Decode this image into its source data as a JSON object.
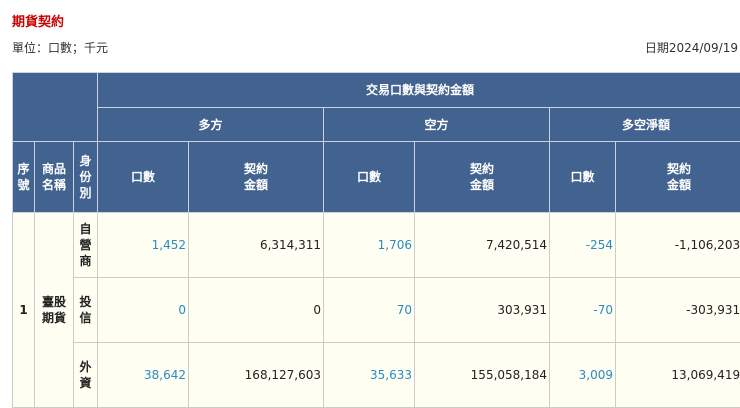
{
  "title": "期貨契約",
  "unit": "單位：口數；千元",
  "date": "日期2024/09/19",
  "header": {
    "group": "交易口數與契約金額",
    "long": "多方",
    "short": "空方",
    "net": "多空淨額",
    "seq": "序號",
    "product": "商品名稱",
    "identity": "身份別",
    "lots": "口數",
    "amount": "契約金額"
  },
  "rows": [
    {
      "seq": "1",
      "product": "臺股期貨",
      "identity": "自營商",
      "long_lots": "1,452",
      "long_amount": "6,314,311",
      "short_lots": "1,706",
      "short_amount": "7,420,514",
      "net_lots": "-254",
      "net_amount": "-1,106,203"
    },
    {
      "identity": "投信",
      "long_lots": "0",
      "long_amount": "0",
      "short_lots": "70",
      "short_amount": "303,931",
      "net_lots": "-70",
      "net_amount": "-303,931"
    },
    {
      "identity": "外資",
      "long_lots": "38,642",
      "long_amount": "168,127,603",
      "short_lots": "35,633",
      "short_amount": "155,058,184",
      "net_lots": "3,009",
      "net_amount": "13,069,419"
    }
  ]
}
